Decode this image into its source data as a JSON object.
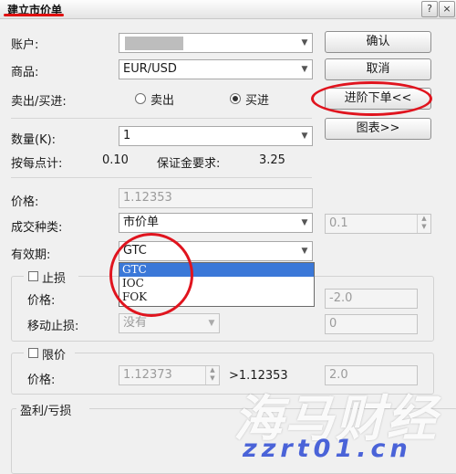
{
  "window": {
    "title": "建立市价单",
    "help_label": "?",
    "close_label": "×"
  },
  "account": {
    "label": "账户:",
    "value": ""
  },
  "product": {
    "label": "商品:",
    "value": "EUR/USD"
  },
  "side": {
    "label": "卖出/买进:",
    "sell_label": "卖出",
    "buy_label": "买进",
    "selected": "买进"
  },
  "quantity": {
    "label": "数量(K):",
    "value": "1"
  },
  "per_pip": {
    "label": "按每点计:",
    "value": "0.10"
  },
  "margin": {
    "label": "保证金要求:",
    "value": "3.25"
  },
  "price": {
    "label": "价格:",
    "value": "1.12353"
  },
  "order_type": {
    "label": "成交种类:",
    "value": "市价单",
    "extra_value": "0.1"
  },
  "validity": {
    "label": "有效期:",
    "value": "GTC",
    "options": [
      "GTC",
      "IOC",
      "FOK"
    ],
    "highlighted": "GTC"
  },
  "stop_loss": {
    "label": "止损",
    "checked": false,
    "price_label": "价格:",
    "price_value": "-2.0",
    "trailing_label": "移动止损:",
    "trailing_value": "没有",
    "trailing_extra": "0"
  },
  "limit": {
    "label": "限价",
    "checked": false,
    "price_label": "价格:",
    "price_value": "1.12373",
    "condition": ">1.12353",
    "pips_value": "2.0"
  },
  "pnl": {
    "label": "盈利/亏损"
  },
  "buttons": {
    "confirm": "确认",
    "cancel": "取消",
    "advanced": "进阶下单<<",
    "chart": "图表>>"
  },
  "watermark": {
    "main": "海马财经",
    "sub": "zzrt01.cn"
  },
  "colors": {
    "annotation_red": "#e0141e",
    "selection_blue": "#3b78d8",
    "watermark_blue": "#4a63d8"
  }
}
